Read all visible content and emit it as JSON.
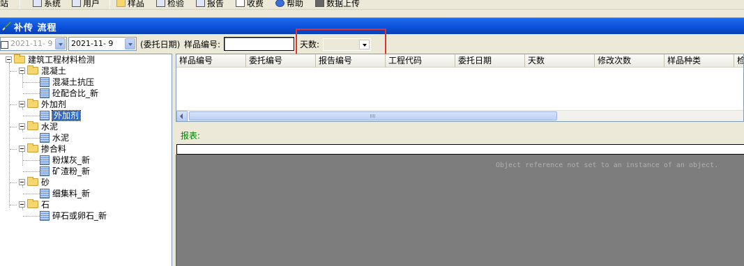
{
  "menu": {
    "items": [
      {
        "label": "站",
        "icon": ""
      },
      {
        "label": "系统",
        "icon": "gears-icon"
      },
      {
        "label": "用户",
        "icon": "user-icon"
      },
      {
        "label": "样品",
        "icon": "star-icon"
      },
      {
        "label": "检验",
        "icon": "monitor-icon"
      },
      {
        "label": "报告",
        "icon": "report-icon"
      },
      {
        "label": "收费",
        "icon": "receipt-icon"
      },
      {
        "label": "帮助",
        "icon": "help-icon"
      },
      {
        "label": "数据上传",
        "icon": "upload-icon"
      }
    ]
  },
  "window": {
    "title": "补传 流程",
    "title_color": "#0a4fd8"
  },
  "filter": {
    "date_from": "2021-11- 9",
    "date_to": "2021-11- 9",
    "date_type_label": "(委托日期)",
    "sample_no_label": "样品编号:",
    "sample_no_value": "",
    "days_label": "天数:",
    "days_value": ""
  },
  "tree": {
    "root": "建筑工程材料检测",
    "groups": [
      {
        "label": "混凝土",
        "children": [
          "混凝土抗压",
          "砼配合比_新"
        ]
      },
      {
        "label": "外加剂",
        "children": [
          "外加剂"
        ]
      },
      {
        "label": "水泥",
        "children": [
          "水泥"
        ]
      },
      {
        "label": "掺合料",
        "children": [
          "粉煤灰_新",
          "矿渣粉_新"
        ]
      },
      {
        "label": "砂",
        "children": [
          "细集料_新"
        ]
      },
      {
        "label": "石",
        "children": [
          "碎石或卵石_新"
        ]
      }
    ],
    "selected": "外加剂"
  },
  "grid": {
    "columns": [
      "样品编号",
      "委托编号",
      "报告编号",
      "工程代码",
      "委托日期",
      "天数",
      "修改次数",
      "样品种类",
      "检"
    ]
  },
  "report": {
    "label": "报表:",
    "error": "Object reference not set to an instance of an object."
  },
  "colors": {
    "highlight": "#e03030",
    "report_label": "#008000",
    "viewer_bg": "#7d7d7d"
  }
}
